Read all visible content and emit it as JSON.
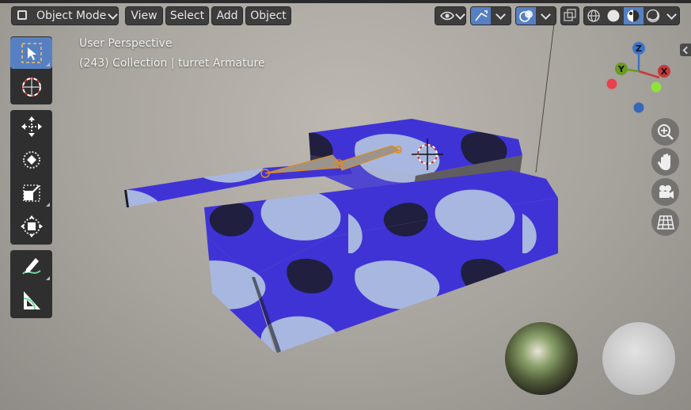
{
  "header": {
    "mode_label": "Object Mode",
    "menus": [
      "View",
      "Select",
      "Add",
      "Object"
    ]
  },
  "viewport": {
    "perspective_label": "User Perspective",
    "collection_label": "(243) Collection | turret Armature"
  },
  "gizmo": {
    "x_label": "X",
    "y_label": "Y",
    "z_label": "Z",
    "colors": {
      "x": "#c6383c",
      "y": "#6a9a1f",
      "z": "#3d72c8"
    }
  },
  "colors": {
    "accent": "#5680c2",
    "camo_blue": "#3f33d6",
    "camo_light": "#a8b7df",
    "camo_dark": "#1b1b24",
    "bone": "#9a948c"
  },
  "icons": {
    "tools": [
      "select-box-icon",
      "cursor-icon",
      "move-icon",
      "rotate-icon",
      "scale-icon",
      "transform-icon",
      "annotate-icon",
      "measure-icon"
    ],
    "nav": [
      "zoom-icon",
      "hand-icon",
      "camera-icon",
      "grid-icon"
    ]
  }
}
